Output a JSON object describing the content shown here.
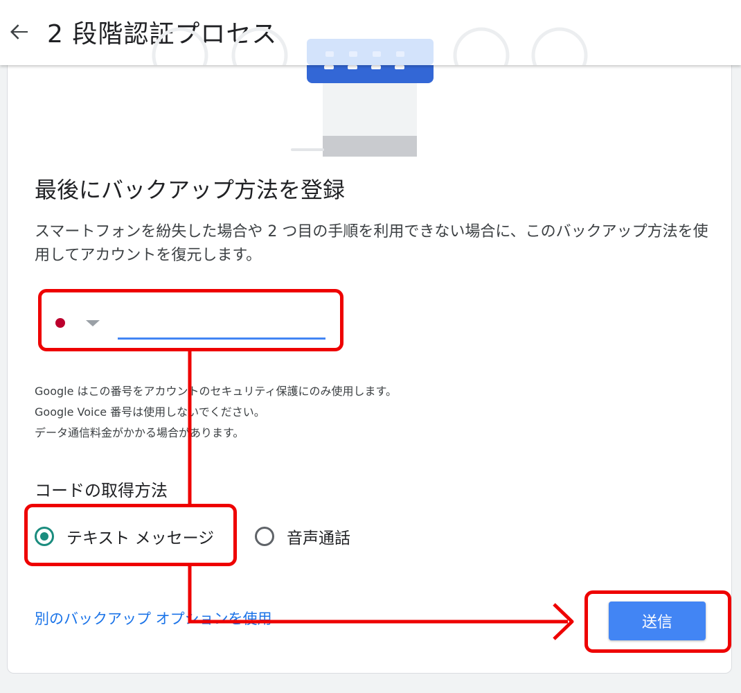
{
  "header": {
    "title": "2 段階認証プロセス",
    "back_icon": "arrow-back-icon"
  },
  "main": {
    "heading": "最後にバックアップ方法を登録",
    "description": "スマートフォンを紛失した場合や 2 つ目の手順を利用できない場合に、このバックアップ方法を使用してアカウントを復元します。",
    "phone": {
      "country_flag": "japan-flag-icon",
      "value": "",
      "placeholder": ""
    },
    "notes": [
      "Google はこの番号をアカウントのセキュリティ保護にのみ使用します。",
      "Google Voice 番号は使用しないでください。",
      "データ通信料金がかかる場合があります。"
    ],
    "code_method": {
      "label": "コードの取得方法",
      "options": [
        {
          "label": "テキスト メッセージ",
          "selected": true
        },
        {
          "label": "音声通話",
          "selected": false
        }
      ]
    },
    "alt_link": "別のバックアップ オプションを使用",
    "send_button": "送信"
  },
  "colors": {
    "accent_blue": "#4285f4",
    "link_blue": "#1a73e8",
    "radio_green": "#1a8c7e",
    "annotation_red": "#ee0000"
  }
}
